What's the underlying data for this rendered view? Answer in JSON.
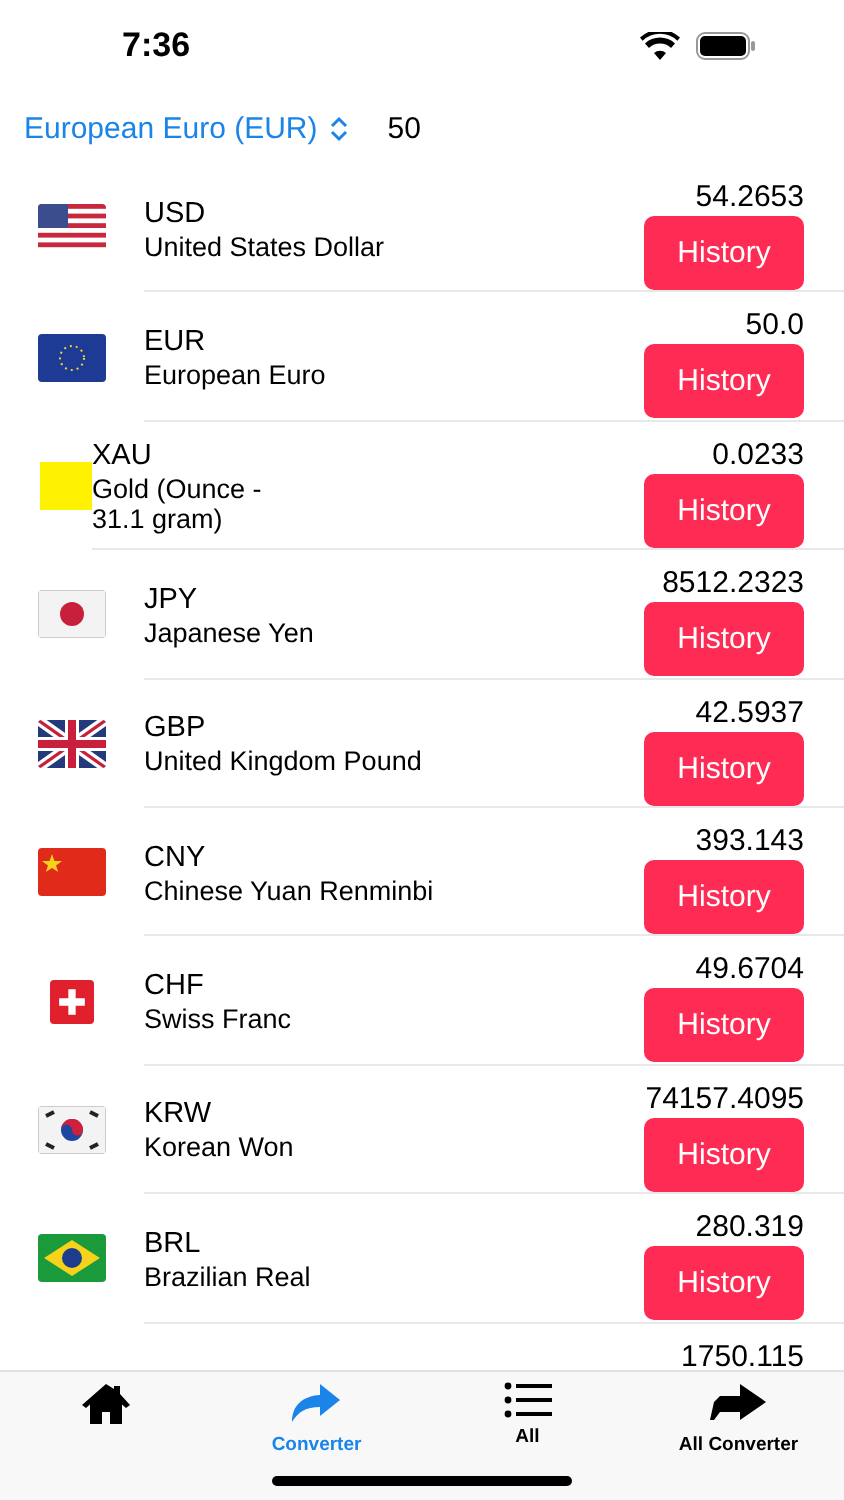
{
  "status_bar": {
    "time": "7:36"
  },
  "header": {
    "currency_picker": "European Euro (EUR)",
    "amount": "50"
  },
  "rows": [
    {
      "kind": "currency",
      "code": "USD",
      "name": "United States Dollar",
      "value": "54.2653",
      "button": "History"
    },
    {
      "kind": "currency",
      "code": "EUR",
      "name": "European Euro",
      "value": "50.0",
      "button": "History"
    },
    {
      "kind": "metal",
      "code": "XAU",
      "name": "Gold (Ounce - 31.1 gram)",
      "value": "0.0233",
      "button": "History"
    },
    {
      "kind": "currency",
      "code": "JPY",
      "name": "Japanese Yen",
      "value": "8512.2323",
      "button": "History"
    },
    {
      "kind": "currency",
      "code": "GBP",
      "name": "United Kingdom Pound",
      "value": "42.5937",
      "button": "History"
    },
    {
      "kind": "currency",
      "code": "CNY",
      "name": "Chinese Yuan Renminbi",
      "value": "393.143",
      "button": "History"
    },
    {
      "kind": "currency",
      "code": "CHF",
      "name": "Swiss Franc",
      "value": "49.6704",
      "button": "History"
    },
    {
      "kind": "currency",
      "code": "KRW",
      "name": "Korean Won",
      "value": "74157.4095",
      "button": "History"
    },
    {
      "kind": "currency",
      "code": "BRL",
      "name": "Brazilian Real",
      "value": "280.319",
      "button": "History"
    },
    {
      "kind": "partial",
      "value": "1750.115"
    }
  ],
  "tab_bar": [
    {
      "selected": false
    },
    {
      "label": "Converter",
      "selected": true
    },
    {
      "label": "All",
      "selected": false
    },
    {
      "label": "All Converter",
      "selected": false
    }
  ]
}
